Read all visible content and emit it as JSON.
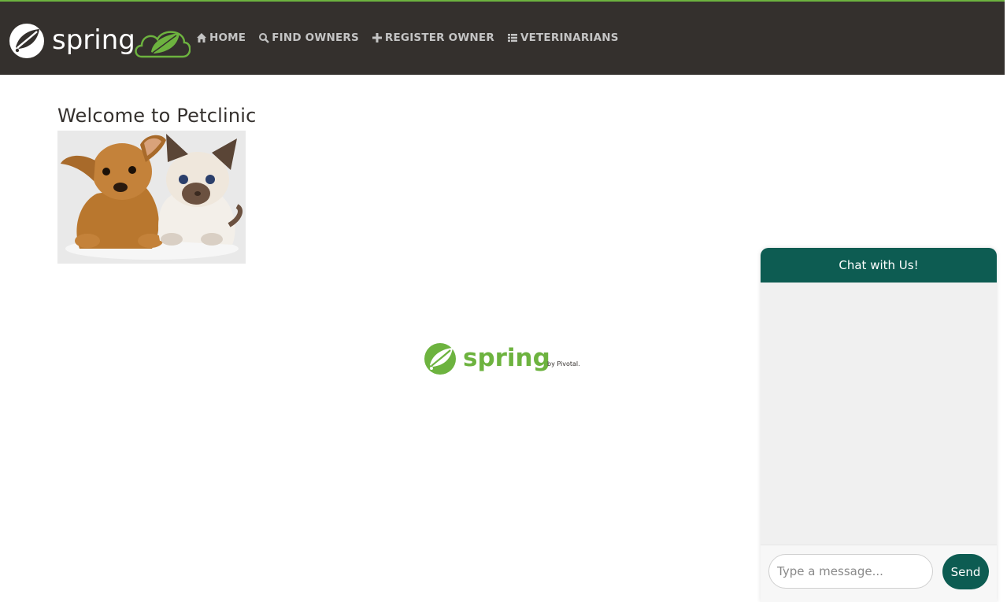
{
  "colors": {
    "navbar_bg": "#34302d",
    "navbar_accent": "#6db33f",
    "nav_text": "#c4c4c4",
    "chat_header": "#0d5c52",
    "spring_green": "#6db33f"
  },
  "brand": {
    "name": "spring"
  },
  "nav": [
    {
      "label": "HOME",
      "icon": "home-icon"
    },
    {
      "label": "FIND OWNERS",
      "icon": "search-icon"
    },
    {
      "label": "REGISTER OWNER",
      "icon": "plus-icon"
    },
    {
      "label": "VETERINARIANS",
      "icon": "list-icon"
    }
  ],
  "main": {
    "title": "Welcome to Petclinic"
  },
  "footer": {
    "logo_text": "spring",
    "by_text": "by Pivotal."
  },
  "chat": {
    "title": "Chat with Us!",
    "input_placeholder": "Type a message...",
    "send_label": "Send"
  }
}
